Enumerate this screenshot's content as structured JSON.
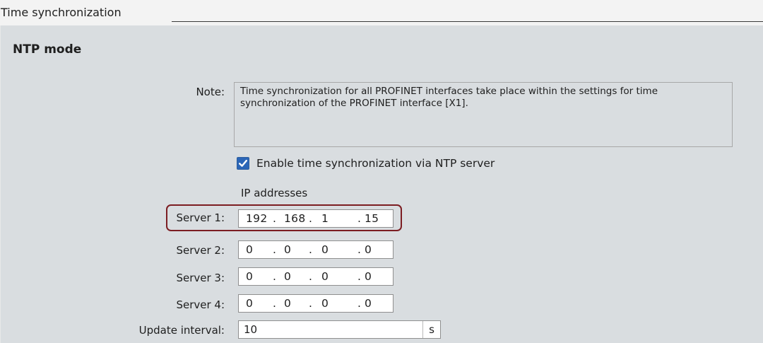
{
  "header": {
    "title": "Time synchronization"
  },
  "section": {
    "title": "NTP mode"
  },
  "note": {
    "label": "Note:",
    "text": "Time synchronization for all PROFINET interfaces take place within the settings for time synchronization of the PROFINET interface [X1]."
  },
  "ntp": {
    "checkbox_label": "Enable time synchronization via NTP server",
    "checked": true,
    "ip_heading": "IP addresses",
    "servers": [
      {
        "label": "Server 1:",
        "octets": [
          "192",
          "168",
          "1",
          "15"
        ]
      },
      {
        "label": "Server 2:",
        "octets": [
          "0",
          "0",
          "0",
          "0"
        ]
      },
      {
        "label": "Server 3:",
        "octets": [
          "0",
          "0",
          "0",
          "0"
        ]
      },
      {
        "label": "Server 4:",
        "octets": [
          "0",
          "0",
          "0",
          "0"
        ]
      }
    ],
    "update_interval": {
      "label": "Update interval:",
      "value": "10",
      "unit": "s"
    }
  },
  "colors": {
    "panel_background": "#d9dde0",
    "highlight_border": "#7c1d22",
    "checkbox_fill": "#2b66b7"
  }
}
